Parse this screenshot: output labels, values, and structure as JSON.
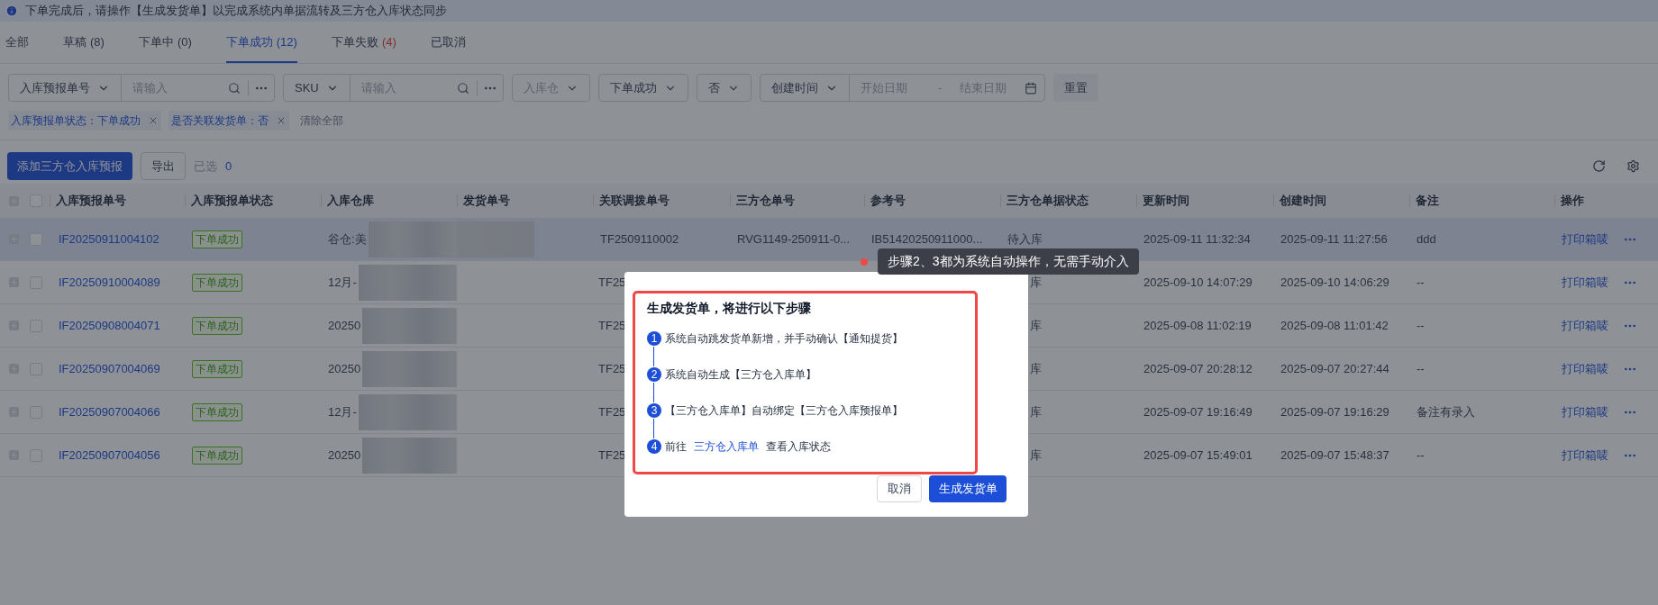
{
  "notice": {
    "text": "下单完成后，请操作【生成发货单】以完成系统内单据流转及三方仓入库状态同步"
  },
  "tabs": [
    {
      "label": "全部",
      "selected": false
    },
    {
      "label": "草稿",
      "count": "(8)",
      "alert": false,
      "selected": false
    },
    {
      "label": "下单中",
      "count": "(0)",
      "alert": false,
      "selected": false
    },
    {
      "label": "下单成功",
      "count": "(12)",
      "alert": false,
      "selected": true
    },
    {
      "label": "下单失败",
      "count": "(4)",
      "alert": true,
      "selected": false
    },
    {
      "label": "已取消",
      "selected": false
    }
  ],
  "filters": [
    {
      "kind": "search_group",
      "select": "入库预报单号",
      "placeholder": "请输入"
    },
    {
      "kind": "search_group",
      "select": "SKU",
      "placeholder": "请输入"
    },
    {
      "kind": "select",
      "placeholder": "入库仓"
    },
    {
      "kind": "select",
      "value": "下单成功"
    },
    {
      "kind": "select",
      "value": "否"
    },
    {
      "kind": "date_range",
      "select": "创建时间",
      "start_placeholder": "开始日期",
      "separator": "-",
      "end_placeholder": "结束日期"
    },
    {
      "kind": "button",
      "label": "重置"
    }
  ],
  "chips": [
    {
      "text": "入库预报单状态：下单成功"
    },
    {
      "text": "是否关联发货单：否"
    }
  ],
  "clear_all": "清除全部",
  "toolbar": {
    "add_button": "添加三方仓入库预报",
    "export_button": "导出",
    "selected_label": "已选",
    "selected_count": "0"
  },
  "table": {
    "header_checked": false,
    "columns": [
      "入库预报单号",
      "入库预报单状态",
      "入库仓库",
      "发货单号",
      "关联调拨单号",
      "三方仓单号",
      "参考号",
      "三方仓单据状态",
      "更新时间",
      "创建时间",
      "备注",
      "操作"
    ],
    "rows": [
      {
        "highlighted": true,
        "checked": false,
        "id": "IF20250911004102",
        "status": "下单成功",
        "warehouse": "谷仓:美",
        "transfer_no": "TF2509110002",
        "third_party_no": "RVG1149-250911-0...",
        "reference_no": "IB51420250911000...",
        "third_party_status": "待入库",
        "updated": "2025-09-11 11:32:34",
        "created": "2025-09-11 11:27:56",
        "remark": "ddd",
        "action": "打印箱唛"
      },
      {
        "highlighted": false,
        "checked": false,
        "id": "IF20250910004089",
        "status": "下单成功",
        "warehouse": "12月-",
        "transfer_no": "TF25",
        "third_party_status": "库",
        "updated": "2025-09-10 14:07:29",
        "created": "2025-09-10 14:06:29",
        "remark": "--",
        "action": "打印箱唛"
      },
      {
        "highlighted": false,
        "checked": false,
        "id": "IF20250908004071",
        "status": "下单成功",
        "warehouse": "20250",
        "transfer_no": "TF25",
        "third_party_status": "库",
        "updated": "2025-09-08 11:02:19",
        "created": "2025-09-08 11:01:42",
        "remark": "--",
        "action": "打印箱唛"
      },
      {
        "highlighted": false,
        "checked": false,
        "id": "IF20250907004069",
        "status": "下单成功",
        "warehouse": "20250",
        "transfer_no": "TF25",
        "third_party_status": "库",
        "updated": "2025-09-07 20:28:12",
        "created": "2025-09-07 20:27:44",
        "remark": "--",
        "action": "打印箱唛"
      },
      {
        "highlighted": false,
        "checked": false,
        "id": "IF20250907004066",
        "status": "下单成功",
        "warehouse": "12月-",
        "transfer_no": "TF25",
        "third_party_status": "库",
        "updated": "2025-09-07 19:16:49",
        "created": "2025-09-07 19:16:29",
        "remark": "备注有录入",
        "action": "打印箱唛"
      },
      {
        "highlighted": false,
        "checked": false,
        "id": "IF20250907004056",
        "status": "下单成功",
        "warehouse": "20250",
        "transfer_no": "TF25",
        "third_party_status": "库",
        "updated": "2025-09-07 15:49:01",
        "created": "2025-09-07 15:48:37",
        "remark": "--",
        "action": "打印箱唛"
      }
    ]
  },
  "dialog": {
    "title": "生成发货单，将进行以下步骤",
    "steps": [
      {
        "number": "1",
        "text": "系统自动跳发货单新增，并手动确认【通知提货】"
      },
      {
        "number": "2",
        "text": "系统自动生成【三方仓入库单】"
      },
      {
        "number": "3",
        "text": "【三方仓入库单】自动绑定【三方仓入库预报单】"
      },
      {
        "number": "4",
        "prefix": "前往",
        "link": "三方仓入库单",
        "suffix": "查看入库状态"
      }
    ],
    "cancel_button": "取消",
    "confirm_button": "生成发货单"
  },
  "tooltip": {
    "text": "步骤2、3都为系统自动操作，无需手动介入"
  }
}
